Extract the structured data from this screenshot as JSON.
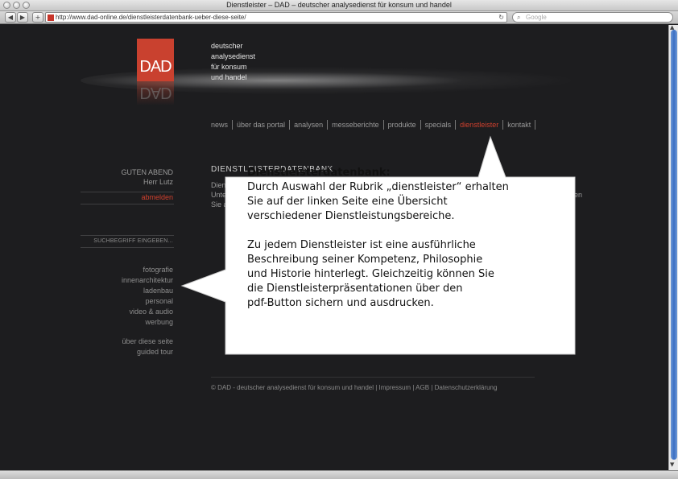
{
  "window": {
    "title": "Dienstleister – DAD – deutscher analysedienst für konsum und handel"
  },
  "toolbar": {
    "back": "◀",
    "forward": "▶",
    "add": "+",
    "url": "http://www.dad-online.de/dienstleisterdatenbank-ueber-diese-seite/",
    "reload": "↻",
    "search_icon": "⌕",
    "search_placeholder": "Google"
  },
  "logo": {
    "text": "DAD"
  },
  "tagline": [
    "deutscher",
    "analysedienst",
    "für konsum",
    "und handel"
  ],
  "nav": [
    {
      "label": "news"
    },
    {
      "label": "über das portal"
    },
    {
      "label": "analysen"
    },
    {
      "label": "messeberichte"
    },
    {
      "label": "produkte"
    },
    {
      "label": "specials"
    },
    {
      "label": "dienstleister",
      "active": true
    },
    {
      "label": "kontakt"
    }
  ],
  "sidebar": {
    "greeting": "GUTEN ABEND",
    "user": "Herr Lutz",
    "logout": "abmelden",
    "search_label": "SUCHBEGRIFF EINGEBEN...",
    "categories": [
      "fotografie",
      "innenarchitektur",
      "ladenbau",
      "personal",
      "video & audio",
      "werbung"
    ],
    "links": [
      "über diese seite",
      "guided tour"
    ]
  },
  "main": {
    "heading": "DIENSTLEISTERDATENBANK",
    "lines": [
      "Dien",
      "Unte",
      "Sie a"
    ],
    "line_tail": "hen"
  },
  "footer": "© DAD - deutscher analysedienst für konsum und handel | Impressum | AGB | Datenschutzerklärung",
  "callout": {
    "title": "Dienstleisterdatenbank:",
    "para1": [
      "Durch Auswahl der Rubrik „dienstleister“ erhalten",
      "Sie auf der linken Seite eine Übersicht",
      "verschiedener Dienstleistungsbereiche."
    ],
    "para2": [
      "Zu jedem Dienstleister ist eine ausführliche",
      "Beschreibung seiner Kompetenz, Philosophie",
      "und Historie hinterlegt. Gleichzeitig können Sie",
      "die Dienstleisterpräsentationen über den",
      "pdf-Button sichern und ausdrucken."
    ]
  },
  "colors": {
    "accent": "#d0402e",
    "logo_bg": "#c9412f",
    "page_bg": "#1d1d1f"
  }
}
